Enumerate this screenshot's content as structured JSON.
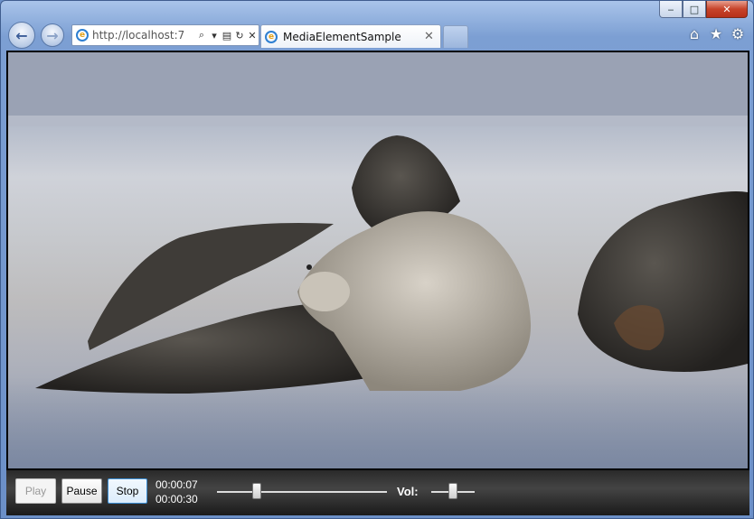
{
  "window": {
    "caption_buttons": {
      "minimize": "‒",
      "maximize": "□",
      "close": "✕"
    }
  },
  "nav": {
    "back_icon": "←",
    "forward_icon": "→",
    "address_url": "http://localhost:7",
    "address_tools": [
      "⌕",
      "▾",
      "▤",
      "↻",
      "✕"
    ]
  },
  "tab": {
    "title": "MediaElementSample",
    "close": "✕"
  },
  "toolbar_icons": [
    "⌂",
    "★",
    "⚙"
  ],
  "media": {
    "play_label": "Play",
    "pause_label": "Pause",
    "stop_label": "Stop",
    "current_time": "00:00:07",
    "total_time": "00:00:30",
    "volume_label": "Vol:",
    "position_fraction": 0.233,
    "volume_fraction": 0.5
  },
  "colors": {
    "sand": "#c9c7c4",
    "seal_light": "#b9b2a7",
    "seal_dark": "#3d3a36"
  }
}
